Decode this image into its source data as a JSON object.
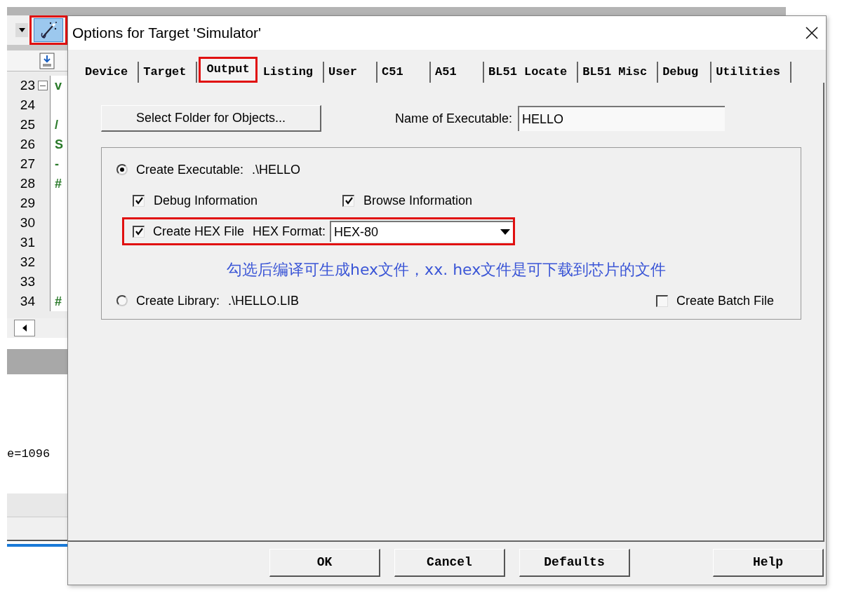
{
  "ide": {
    "code_lines": [
      {
        "number": "23",
        "fold_box": true,
        "text": "v"
      },
      {
        "number": "24",
        "fold_box": false
      },
      {
        "number": "25",
        "fold_box": false,
        "text": "/"
      },
      {
        "number": "26",
        "fold_box": false,
        "text": "S"
      },
      {
        "number": "27",
        "fold_box": false,
        "text": "-"
      },
      {
        "number": "28",
        "fold_box": false,
        "text": "#"
      },
      {
        "number": "29",
        "fold_box": false
      },
      {
        "number": "30",
        "fold_box": false
      },
      {
        "number": "31",
        "fold_box": false
      },
      {
        "number": "32",
        "fold_box": false
      },
      {
        "number": "33",
        "fold_box": false
      },
      {
        "number": "34",
        "fold_box": false,
        "text": "#"
      }
    ],
    "output_text": "e=1096"
  },
  "dialog": {
    "title": "Options for Target 'Simulator'",
    "tabs": [
      {
        "label": "Device",
        "selected": false
      },
      {
        "label": "Target",
        "selected": false
      },
      {
        "label": "Output",
        "selected": true
      },
      {
        "label": "Listing",
        "selected": false
      },
      {
        "label": "User",
        "selected": false
      },
      {
        "label": "C51",
        "selected": false
      },
      {
        "label": "A51",
        "selected": false
      },
      {
        "label": "BL51 Locate",
        "selected": false
      },
      {
        "label": "BL51 Misc",
        "selected": false
      },
      {
        "label": "Debug",
        "selected": false
      },
      {
        "label": "Utilities",
        "selected": false
      }
    ],
    "select_folder_button": "Select Folder for Objects...",
    "name_of_executable": {
      "label": "Name of Executable:",
      "value": "HELLO"
    },
    "create_executable": {
      "label": "Create Executable:",
      "path": ".\\HELLO",
      "selected": true
    },
    "debug_information": {
      "label": "Debug Information",
      "checked": true
    },
    "browse_information": {
      "label": "Browse Information",
      "checked": true
    },
    "create_hex_file": {
      "label": "Create HEX File",
      "checked": true
    },
    "hex_format": {
      "label": "HEX Format:",
      "value": "HEX-80"
    },
    "annotation": "勾选后编译可生成hex文件，xx. hex文件是可下载到芯片的文件",
    "create_library": {
      "label": "Create Library:",
      "path": ".\\HELLO.LIB",
      "selected": false
    },
    "create_batch_file": {
      "label": "Create Batch File",
      "checked": false
    },
    "buttons": [
      "OK",
      "Cancel",
      "Defaults",
      "Help"
    ]
  }
}
